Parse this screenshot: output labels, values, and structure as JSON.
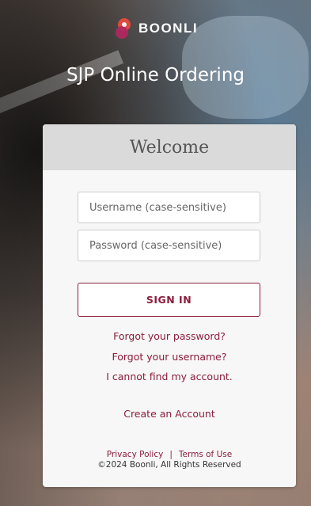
{
  "brand": {
    "name": "BOONLI",
    "logo_icon": "boonli-logo-icon",
    "accent_color": "#8b1d3b",
    "logo_colors": [
      "#e0483d",
      "#b3275e"
    ]
  },
  "app_title": "SJP Online Ordering",
  "login_card": {
    "title": "Welcome",
    "username": {
      "value": "",
      "placeholder": "Username (case-sensitive)"
    },
    "password": {
      "value": "",
      "placeholder": "Password (case-sensitive)"
    },
    "sign_in_label": "SIGN IN",
    "forgot_password": "Forgot your password?",
    "forgot_username": "Forgot your username?",
    "cannot_find_account": "I cannot find my account.",
    "create_account": "Create an Account",
    "footer": {
      "privacy_policy": "Privacy Policy",
      "separator": "|",
      "terms_of_use": "Terms of Use",
      "copyright": "©2024 Boonli, All Rights Reserved"
    }
  }
}
